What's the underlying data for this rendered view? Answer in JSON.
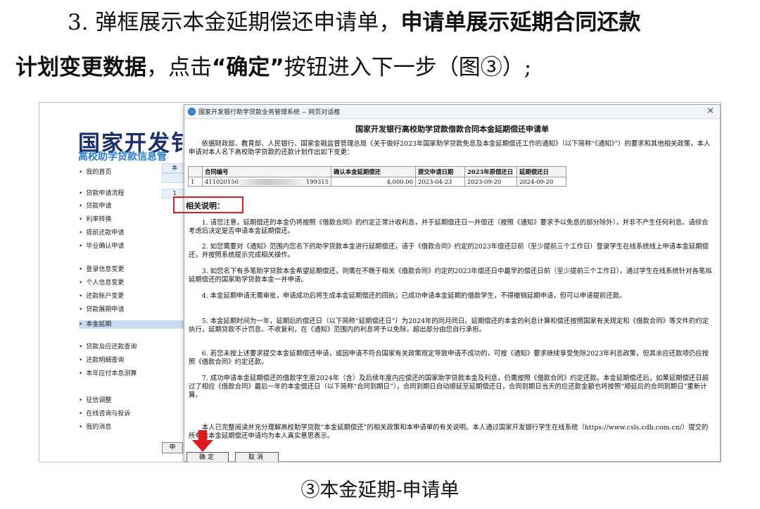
{
  "doc": {
    "line1_normal": "3. 弹框展示本金延期偿还申请单，",
    "line1_bold": "申请单展示延期合同还款",
    "line2_bold": "计划变更数据",
    "line2_normal_a": "，点击",
    "line2_bold_b": "“确定”",
    "line2_normal_b": "按钮进入下一步（图③）;",
    "caption": "③本金延期-申请单"
  },
  "app": {
    "brand": "国家开发钅",
    "brand_sub": "高校助学贷款信息管",
    "menu": [
      "我的首页",
      "贷款申请流程",
      "贷款申请",
      "利率转换",
      "提前还款申请",
      "毕业确认申请",
      "登录信息变更",
      "个人信息变更",
      "还款账户变更",
      "贷款展期申请",
      "本金延期",
      "贷款及应还款查询",
      "还款明细查询",
      "本年应付本息测算",
      "征信调整",
      "在线咨询与投诉",
      "我的消息"
    ],
    "active_item": "本金延期",
    "side_cells": [
      "本",
      "",
      "1"
    ],
    "bottom_button": "申"
  },
  "dialog": {
    "window_title": "国家开发银行助学贷款业务管理系统 -- 网页对话框",
    "close": "×",
    "form_title": "国家开发银行高校助学贷款借款合同本金延期偿还申请单",
    "intro": "依据财政部、教育部、人民银行、国家金融监督管理总局《关于做好2023年国家助学贷款免息及本金延期偿还工作的通知》（以下简称“《通知》”）的要求和其他相关政策，本人申请对本人名下高校助学贷款的还款计划作出如下变更：",
    "table": {
      "headers": [
        "",
        "合同编号",
        "确认本金延期偿还",
        "提交申请日期",
        "2023年原偿还日",
        "延期偿还日"
      ],
      "rows": [
        {
          "no": "1",
          "contract_prefix": "411020150",
          "contract_suffix": "199315",
          "amount": "4,000.00",
          "submit_date": "2023-04-23",
          "original_date": "2023-09-20",
          "deferred_date": "2024-09-20"
        }
      ]
    },
    "notes_title": "相关说明：",
    "notes": [
      "1. 请您注意，延期偿还的本金仍将按照《借款合同》的约定正常计收利息，并于延期偿还日一并偿还（按照《通知》要求予以免息的部分除外），并非不产生任何利息。请综合考虑后决定是否申请本金延期偿还。",
      "2. 如您需要对《通知》范围内您名下的助学贷款本金进行延期偿还，请于《借款合同》约定的2023年偿还日前（至少提前三个工作日）登录学生在线系统线上申请本金延期偿还，并按照系统提示完成相关操作。",
      "3. 如您名下有多笔助学贷款本金希望延期偿还，则需在不晚于相关《借款合同》约定的2023年偿还日中最早的偿还日前（至少提前三个工作日），通过学生在线系统针对各笔拟延期偿还的国家助学贷款本金一并申请。",
      "4. 本金延期申请无需审批，申请成功后将生成本金延期偿还的回执；已成功申请本金延期的借款学生，不得撤销延期申请，但可以申请提前还款。",
      "5. 本金延期时间为一年，延期后的偿还日（以下简称“延期偿还日”）为2024年的同月同日。延期偿还的本金的利息计算和偿还按照国家有关规定和《借款合同》等文件的约定执行，延期贷款不计罚息、不收复利，在《通知》范围内的利息将予以免除，超出部分由您自行承担。",
      "6. 若您未按上述要求提交本金延期偿还申请，或因申请不符合国家有关政策规定导致申请不成功的，可按《通知》要求继续享受免除2023年利息政策，但其余应还款项仍应按照《借款合同》约定还款。",
      "7. 成功申请本金延期偿还的借款学生原2024年（含）及后续年度内应偿还的国家助学贷款本金及利息，仍需按照《借款合同》约定还款。本金延期偿还后，如果延期偿还日超过了相应《借款合同》最后一年的本金偿还日（以下简称“合同到期日”），合同到期日自动顺延至延期偿还日，合同到期日当天的应还款金额也将按照“顺延后的合同到期日”重新计算。"
    ],
    "confirm_text": "本人已完整阅读并充分理解高校助学贷款“本金延期偿还”的相关政策和本申请单的有关说明。本人通过国家开发银行学生在线系统（https://www.csls.cdb.com.cn/）提交的所有的本金延期偿还申请均为本人真实意思表示。",
    "ok_label": "确定",
    "cancel_label": "取消"
  },
  "colors": {
    "highlight_box": "#e02020",
    "brand": "#1b2f6b",
    "brand_sub": "#2a7fd4",
    "active_menu": "#c9dcf2"
  }
}
